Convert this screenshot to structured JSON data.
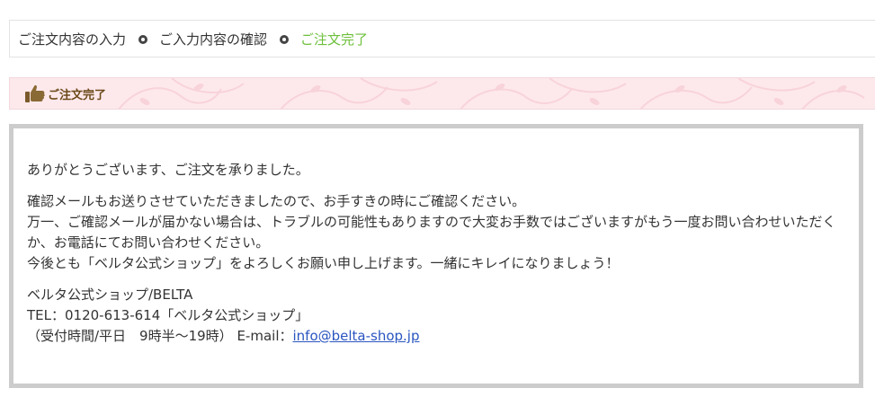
{
  "steps": [
    {
      "label": "ご注文内容の入力",
      "current": false
    },
    {
      "label": "ご入力内容の確認",
      "current": false
    },
    {
      "label": "ご注文完了",
      "current": true
    }
  ],
  "colors": {
    "current_step": "#6cbf3a",
    "heading_bg": "#fde9ec",
    "heading_text": "#6b4a1a",
    "box_border": "#cccccc",
    "link": "#2a55c0"
  },
  "heading": {
    "icon": "thumbs-up-icon",
    "title": "ご注文完了"
  },
  "message": {
    "thanks": "ありがとうございます、ご注文を承りました。",
    "line1": "確認メールもお送りさせていただきましたので、お手すきの時にご確認ください。",
    "line2": "万一、ご確認メールが届かない場合は、トラブルの可能性もありますので大変お手数ではございますがもう一度お問い合わせいただくか、お電話にてお問い合わせください。",
    "line3": "今後とも「ベルタ公式ショップ」をよろしくお願い申し上げます。一緒にキレイになりましょう！",
    "shop_name": "ベルタ公式ショップ/BELTA",
    "tel": "TEL：0120-613-614「ベルタ公式ショップ」",
    "hours_prefix": "（受付時間/平日　9時半～19時） E-mail：",
    "email": "info@belta-shop.jp"
  }
}
